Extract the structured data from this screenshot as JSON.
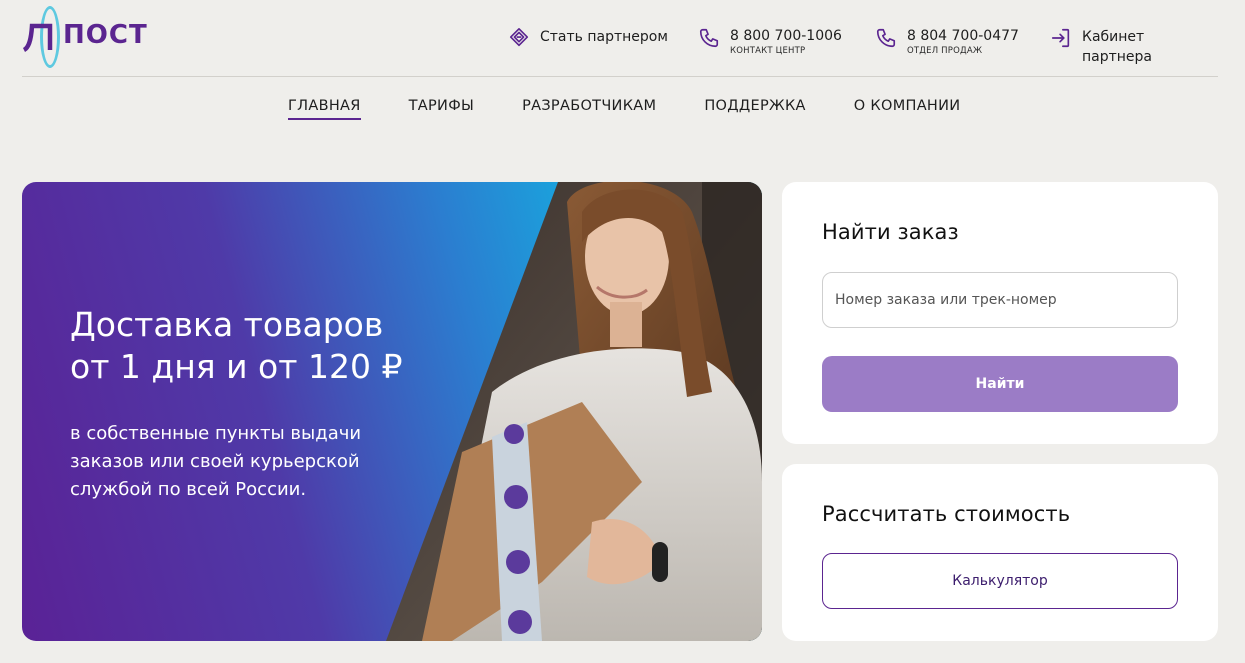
{
  "brand": {
    "logo_text": "ПОСТ",
    "primary_color": "#5b2590",
    "accent_color": "#5ec9e0"
  },
  "header": {
    "partner": {
      "label": "Стать партнером",
      "icon": "partner-handshake-icon"
    },
    "phone_contact": {
      "number": "8 800 700-1006",
      "caption": "КОНТАКТ ЦЕНТР",
      "icon": "phone-icon"
    },
    "phone_sales": {
      "number": "8 804 700-0477",
      "caption": "ОТДЕЛ ПРОДАЖ",
      "icon": "phone-icon"
    },
    "cabinet": {
      "label": "Кабинет партнера",
      "icon": "login-icon"
    }
  },
  "nav": {
    "items": [
      {
        "label": "ГЛАВНАЯ",
        "active": true
      },
      {
        "label": "ТАРИФЫ",
        "active": false
      },
      {
        "label": "РАЗРАБОТЧИКАМ",
        "active": false
      },
      {
        "label": "ПОДДЕРЖКА",
        "active": false
      },
      {
        "label": "О КОМПАНИИ",
        "active": false
      }
    ]
  },
  "hero": {
    "title_line1": "Доставка товаров",
    "title_line2": "от 1 дня и от 120 ₽",
    "subtitle": "в собственные пункты выдачи заказов или своей курьерской службой по всей России."
  },
  "find_order": {
    "title": "Найти заказ",
    "placeholder": "Номер заказа или трек-номер",
    "value": "",
    "button_label": "Найти",
    "button_color": "#9b7cc6"
  },
  "calculate": {
    "title": "Рассчитать стоимость",
    "button_label": "Калькулятор"
  }
}
